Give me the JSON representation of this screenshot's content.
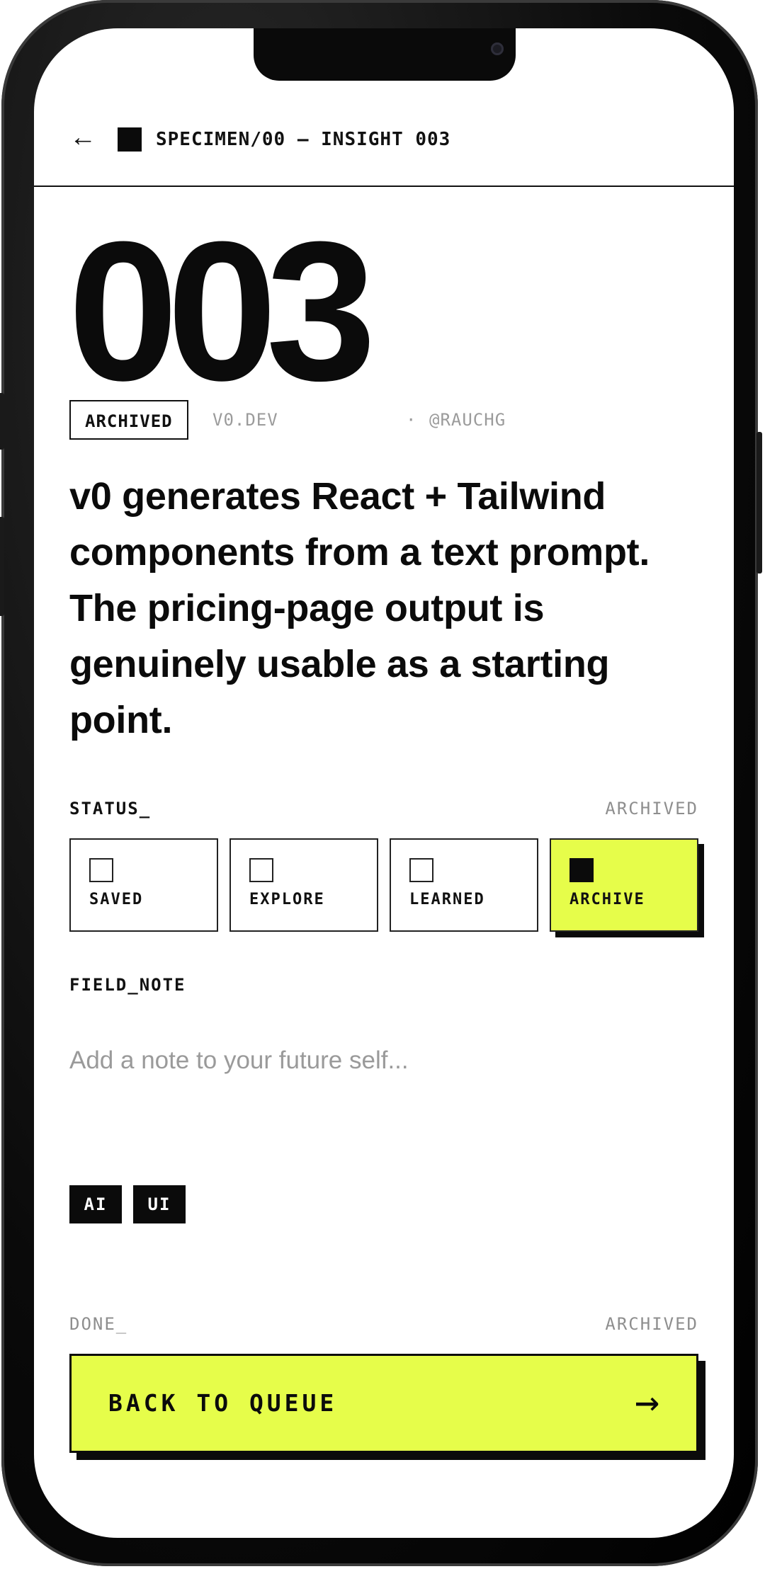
{
  "header": {
    "back_icon": "←",
    "breadcrumb": "SPECIMEN/00 — INSIGHT 003"
  },
  "insight": {
    "number": "003",
    "status_badge": "ARCHIVED",
    "source": "V0.DEV",
    "separator": "·",
    "author": "@RAUCHG",
    "text": "v0 generates React + Tailwind components from a text prompt. The pricing-page output is genuinely usable as a starting point."
  },
  "status": {
    "label": "STATUS_",
    "current": "ARCHIVED",
    "options": [
      {
        "label": "SAVED",
        "selected": false
      },
      {
        "label": "EXPLORE",
        "selected": false
      },
      {
        "label": "LEARNED",
        "selected": false
      },
      {
        "label": "ARCHIVE",
        "selected": true
      }
    ]
  },
  "field_note": {
    "label": "FIELD_NOTE",
    "value": "",
    "placeholder": "Add a note to your future self..."
  },
  "tags": [
    "AI",
    "UI"
  ],
  "footer": {
    "done_label": "DONE_",
    "done_status": "ARCHIVED",
    "cta_label": "BACK TO QUEUE",
    "cta_icon": "→"
  },
  "colors": {
    "accent": "#e6fd4a",
    "ink": "#0b0b0b",
    "muted": "#9b9b9b"
  }
}
